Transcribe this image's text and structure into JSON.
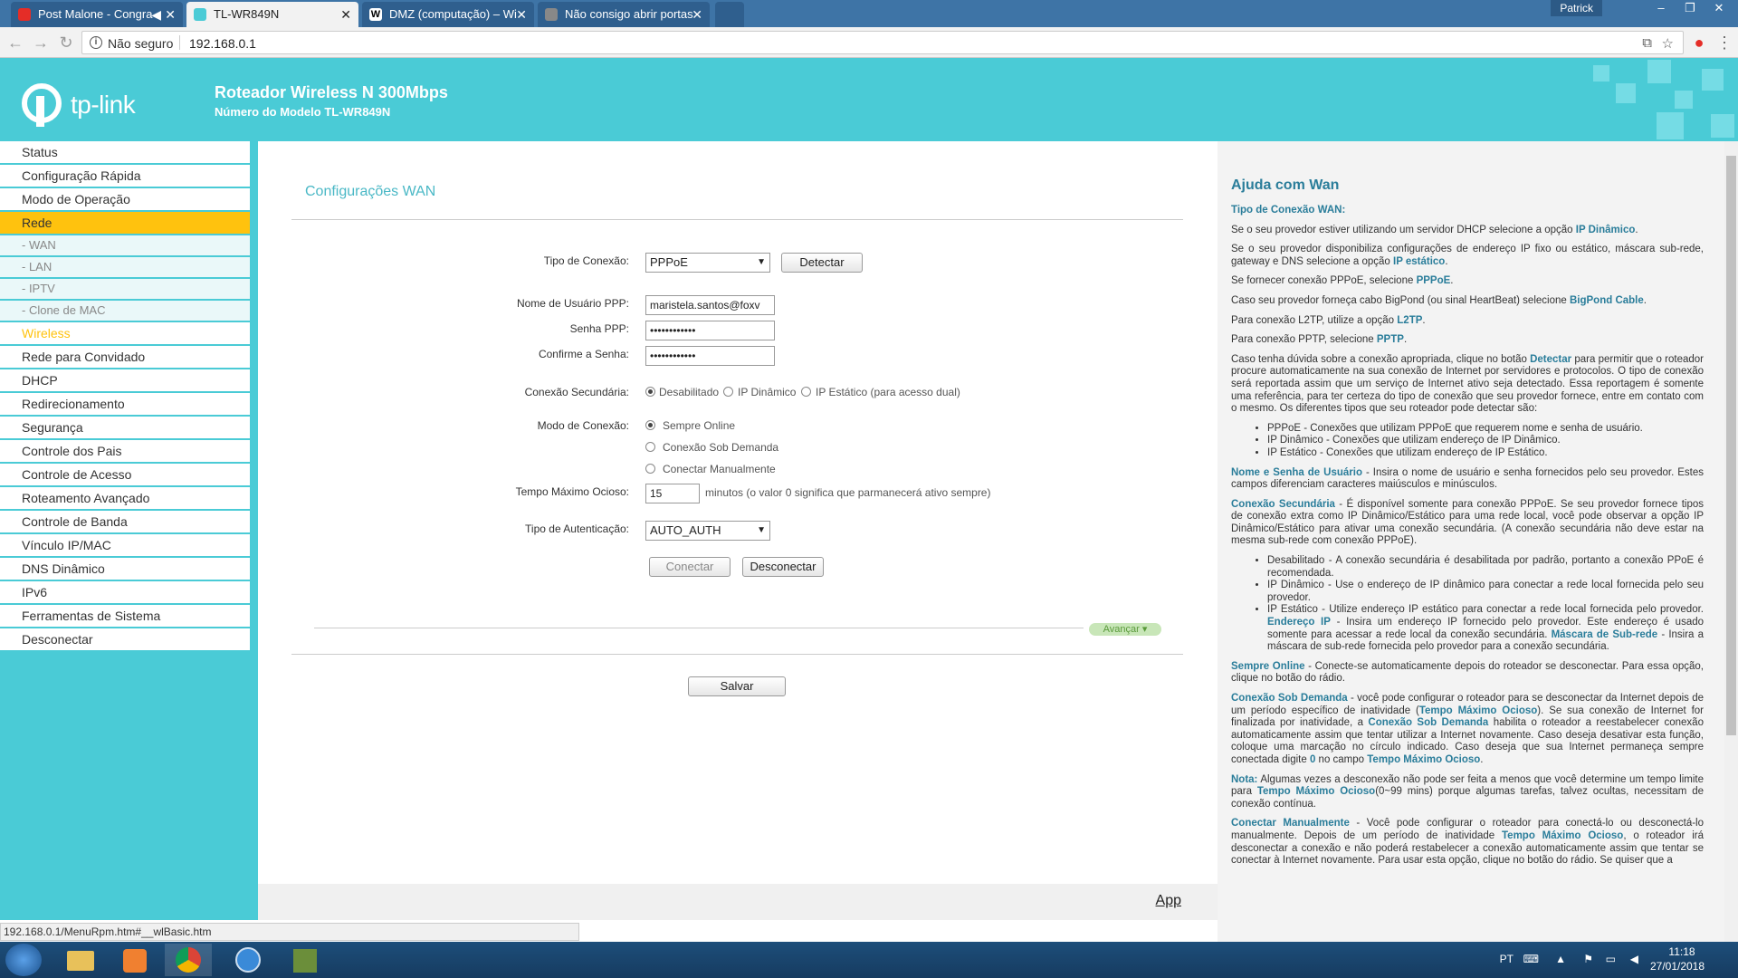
{
  "browser": {
    "tabs": [
      {
        "label": "Post Malone - Congra",
        "icon_color": "#e52d27"
      },
      {
        "label": "TL-WR849N",
        "icon_color": "#4acbd6"
      },
      {
        "label": "DMZ (computação) – Wi",
        "icon_color": "#ffffff"
      },
      {
        "label": "Não consigo abrir portas",
        "icon_color": "#888888"
      }
    ],
    "user": "Patrick",
    "security_label": "Não seguro",
    "url": "192.168.0.1"
  },
  "header": {
    "brand": "tp-link",
    "title": "Roteador Wireless N 300Mbps",
    "model": "Número do Modelo TL-WR849N"
  },
  "sidebar": {
    "items": [
      {
        "label": "Status",
        "type": "main"
      },
      {
        "label": "Configuração Rápida",
        "type": "main"
      },
      {
        "label": "Modo de Operação",
        "type": "main"
      },
      {
        "label": "Rede",
        "type": "selected"
      },
      {
        "label": "- WAN",
        "type": "sub"
      },
      {
        "label": "- LAN",
        "type": "sub"
      },
      {
        "label": "- IPTV",
        "type": "sub"
      },
      {
        "label": "- Clone de MAC",
        "type": "sub"
      },
      {
        "label": "Wireless",
        "type": "wireless"
      },
      {
        "label": "Rede para Convidado",
        "type": "main"
      },
      {
        "label": "DHCP",
        "type": "main"
      },
      {
        "label": "Redirecionamento",
        "type": "main"
      },
      {
        "label": "Segurança",
        "type": "main"
      },
      {
        "label": "Controle dos Pais",
        "type": "main"
      },
      {
        "label": "Controle de Acesso",
        "type": "main"
      },
      {
        "label": "Roteamento Avançado",
        "type": "main"
      },
      {
        "label": "Controle de Banda",
        "type": "main"
      },
      {
        "label": "Vínculo IP/MAC",
        "type": "main"
      },
      {
        "label": "DNS Dinâmico",
        "type": "main"
      },
      {
        "label": "IPv6",
        "type": "main"
      },
      {
        "label": "Ferramentas de Sistema",
        "type": "main"
      },
      {
        "label": "Desconectar",
        "type": "main"
      }
    ]
  },
  "form": {
    "title": "Configurações WAN",
    "conn_type_label": "Tipo de Conexão:",
    "conn_type_value": "PPPoE",
    "detect_label": "Detectar",
    "user_label": "Nome de Usuário PPP:",
    "user_value": "maristela.santos@foxv",
    "pass_label": "Senha PPP:",
    "pass_value": "••••••••••••",
    "confirm_label": "Confirme a Senha:",
    "confirm_value": "••••••••••••",
    "secondary_label": "Conexão Secundária:",
    "secondary_opts": [
      "Desabilitado",
      "IP Dinâmico",
      "IP Estático (para acesso dual)"
    ],
    "mode_label": "Modo de Conexão:",
    "mode_opts": [
      "Sempre Online",
      "Conexão Sob Demanda",
      "Conectar Manualmente"
    ],
    "idle_label": "Tempo Máximo Ocioso:",
    "idle_value": "15",
    "idle_hint": "minutos (o valor 0 significa que parmanecerá ativo sempre)",
    "auth_label": "Tipo de Autenticação:",
    "auth_value": "AUTO_AUTH",
    "connect_label": "Conectar",
    "disconnect_label": "Desconectar",
    "advanced_label": "Avançar",
    "save_label": "Salvar",
    "app_label": "App"
  },
  "help": {
    "title": "Ajuda com Wan"
  },
  "status_bar": "192.168.0.1/MenuRpm.htm#__wlBasic.htm",
  "taskbar": {
    "lang": "PT",
    "time": "11:18",
    "date": "27/01/2018"
  }
}
